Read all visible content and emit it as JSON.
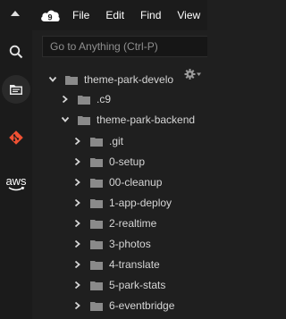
{
  "menubar": {
    "items": [
      "File",
      "Edit",
      "Find",
      "View"
    ]
  },
  "goto": {
    "placeholder": "Go to Anything (Ctrl-P)"
  },
  "sidebar": {
    "icons": [
      "search-icon",
      "environment-icon",
      "source-control-icon",
      "aws-icon"
    ],
    "aws_label": "aws"
  },
  "tree": {
    "root": "theme-park-develo",
    "items": [
      {
        "label": ".c9"
      },
      {
        "label": "theme-park-backend"
      },
      {
        "label": ".git"
      },
      {
        "label": "0-setup"
      },
      {
        "label": "00-cleanup"
      },
      {
        "label": "1-app-deploy"
      },
      {
        "label": "2-realtime"
      },
      {
        "label": "3-photos"
      },
      {
        "label": "4-translate"
      },
      {
        "label": "5-park-stats"
      },
      {
        "label": "6-eventbridge"
      }
    ]
  },
  "colors": {
    "background": "#1f1f1f",
    "folder": "#8a8a8a",
    "text": "#d6d6d6"
  }
}
